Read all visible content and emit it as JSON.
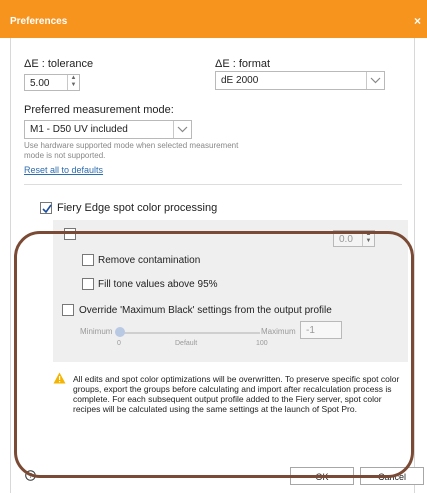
{
  "window": {
    "title": "Preferences",
    "close_glyph": "×",
    "accent_color": "#f7941e"
  },
  "delta_e": {
    "tolerance_label": "ΔE : tolerance",
    "tolerance_value": "5.00",
    "format_label": "ΔE : format",
    "format_value": "dE 2000"
  },
  "measurement": {
    "label": "Preferred measurement mode:",
    "value": "M1 - D50 UV included",
    "hint": "Use hardware supported mode when selected measurement mode is not supported."
  },
  "reset_link": "Reset all to defaults",
  "spot": {
    "label": "Fiery Edge spot color processing",
    "checked": true,
    "first_option_value": "0.0",
    "remove_contamination": "Remove contamination",
    "fill_tone": "Fill tone values above 95%",
    "override_label": "Override 'Maximum Black' settings from the output profile",
    "slider": {
      "min_label": "Minimum",
      "max_label": "Maximum",
      "value_box": "-1",
      "tick_min": "0",
      "tick_default": "Default",
      "tick_max": "100",
      "knob_fraction": 0
    }
  },
  "warning": {
    "icon": "warning-triangle-icon",
    "text": "All edits and spot color optimizations will be overwritten. To preserve specific spot color groups, export the groups before calculating and import after recalculation process is complete. For each subsequent output profile added to the Fiery server, spot color recipes will be calculated using the same settings at the launch of Spot Pro."
  },
  "footer": {
    "help_glyph": "?",
    "ok_label": "OK",
    "cancel_label": "Cancel"
  }
}
